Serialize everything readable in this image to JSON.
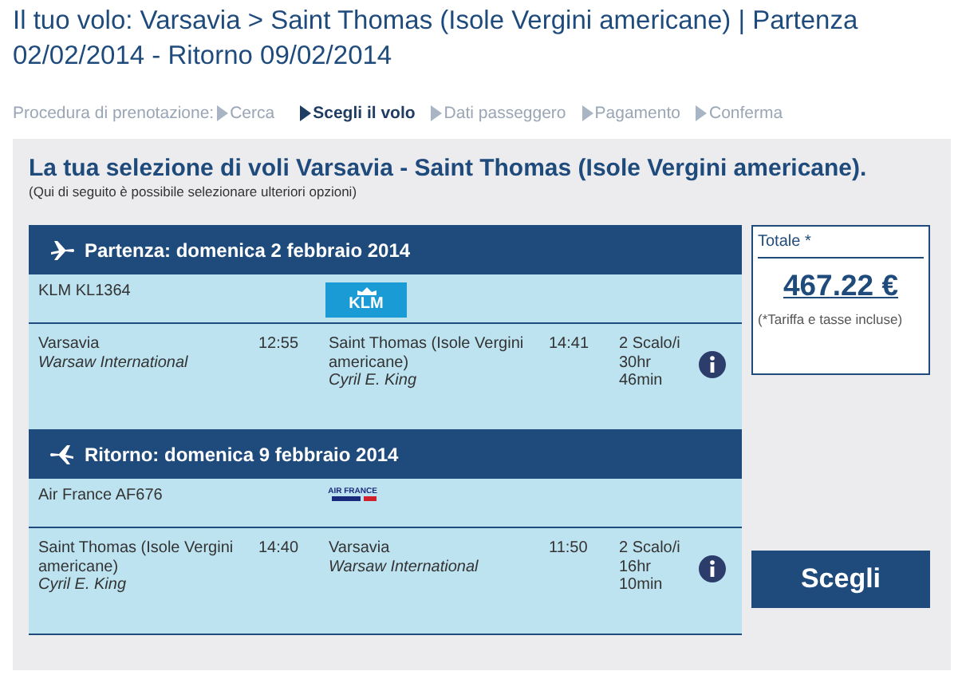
{
  "page_title": "Il tuo volo: Varsavia > Saint Thomas (Isole Vergini americane) | Partenza 02/02/2014 - Ritorno 09/02/2014",
  "breadcrumb": {
    "label": "Procedura di prenotazione:",
    "steps": [
      {
        "label": "Cerca",
        "selected": false
      },
      {
        "label": "Scegli il volo",
        "selected": true
      },
      {
        "label": "Dati passeggero",
        "selected": false
      },
      {
        "label": "Pagamento",
        "selected": false
      },
      {
        "label": "Conferma",
        "selected": false
      }
    ]
  },
  "selection": {
    "heading": "La tua selezione di voli Varsavia - Saint Thomas (Isole Vergini americane).",
    "subheading": "(Qui di seguito è possibile selezionare ulteriori opzioni)"
  },
  "flights": [
    {
      "kind": "outbound",
      "header": "Partenza: domenica 2 febbraio 2014",
      "airline": "KLM KL1364",
      "logo": {
        "kind": "klm",
        "text": "KLM"
      },
      "from_city": "Varsavia",
      "from_airport": "Warsaw International",
      "depart_time": "12:55",
      "to_city": "Saint Thomas (Isole Vergini americane)",
      "to_airport": "Cyril E. King",
      "arrive_time": "14:41",
      "stops": "2 Scalo/i 30hr 46min"
    },
    {
      "kind": "return",
      "header": "Ritorno: domenica 9 febbraio 2014",
      "airline": "Air France AF676",
      "logo": {
        "kind": "airfrance",
        "text": "AIR FRANCE"
      },
      "from_city": "Saint Thomas (Isole Vergini americane)",
      "from_airport": "Cyril E. King",
      "depart_time": "14:40",
      "to_city": "Varsavia",
      "to_airport": "Warsaw International",
      "arrive_time": "11:50",
      "stops": "2 Scalo/i 16hr 10min"
    }
  ],
  "total": {
    "label": "Totale *",
    "price": "467.22 €",
    "note": "(*Tariffa e tasse incluse)"
  },
  "select_button": "Scegli"
}
